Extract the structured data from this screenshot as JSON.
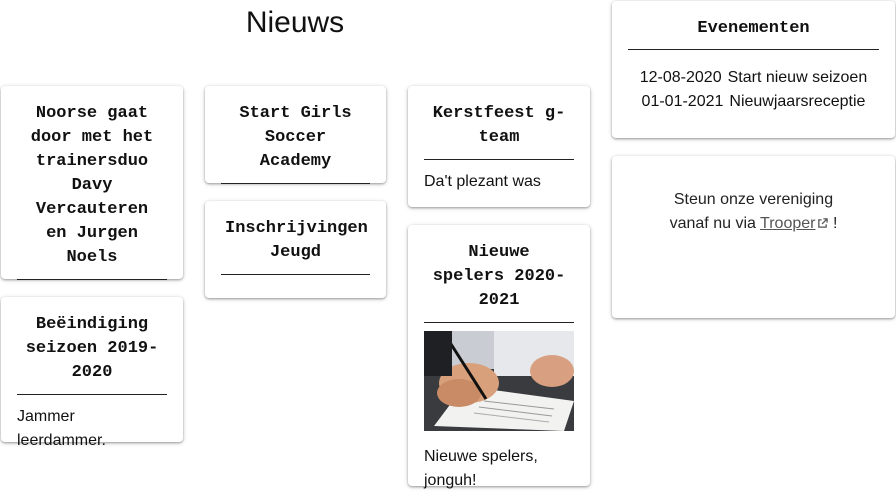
{
  "page": {
    "title": "Nieuws"
  },
  "news": [
    {
      "title": "Noorse gaat door met het trainersduo Davy Vercauteren en Jurgen Noels",
      "text": ""
    },
    {
      "title": "Beëindiging seizoen 2019-2020",
      "text": "Jammer leerdammer."
    },
    {
      "title": "Start Girls Soccer Academy",
      "text": ""
    },
    {
      "title": "Inschrijvingen Jeugd",
      "text": ""
    },
    {
      "title": "Kerstfeest g-team",
      "text": "Da't plezant was"
    },
    {
      "title": "Nieuwe spelers 2020-2021",
      "text": "Nieuwe spelers, jonguh!",
      "image": "contract-signing-photo"
    }
  ],
  "events": {
    "title": "Evenementen",
    "items": [
      {
        "date": "12-08-2020",
        "name": "Start nieuw seizoen"
      },
      {
        "date": "01-01-2021",
        "name": "Nieuwjaarsreceptie"
      }
    ]
  },
  "support": {
    "line1": "Steun onze vereniging",
    "prefix": "vanaf nu via",
    "link": "Trooper",
    "suffix": "!",
    "icon": "external-link-icon"
  }
}
